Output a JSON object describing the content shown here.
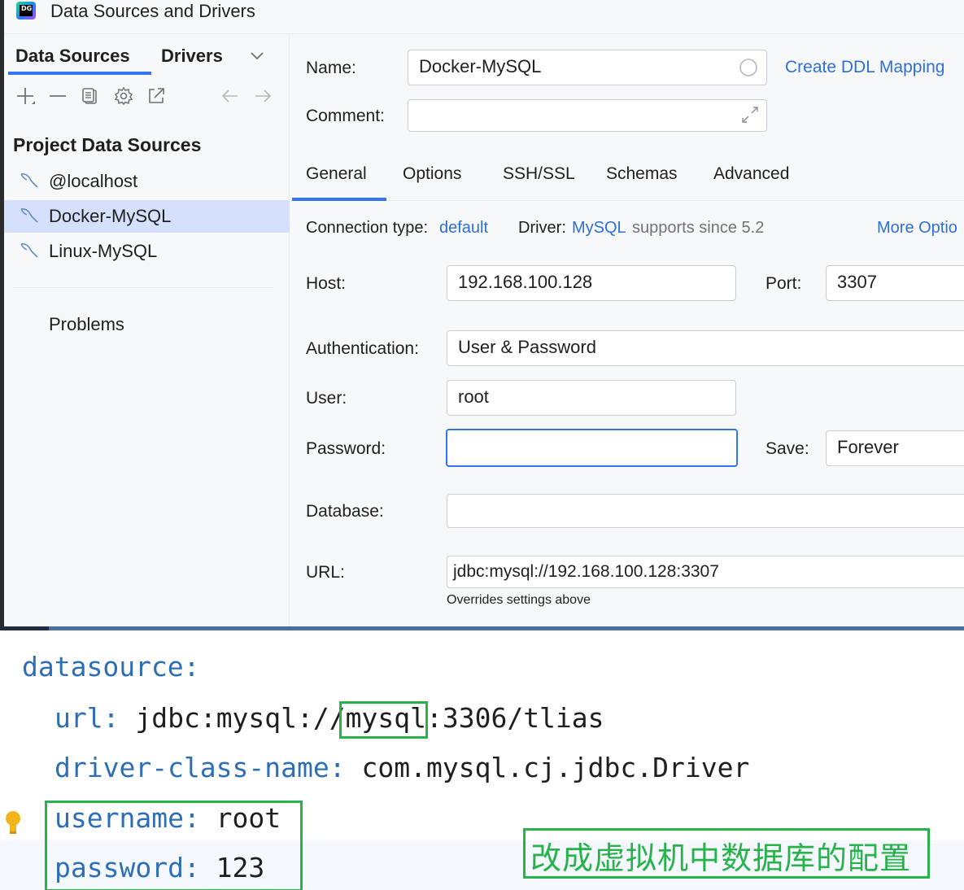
{
  "window": {
    "title": "Data Sources and Drivers",
    "logo_text": "DG"
  },
  "left_pane": {
    "tabs": [
      "Data Sources",
      "Drivers"
    ],
    "toolbar_icons": [
      "add-icon",
      "remove-icon",
      "duplicate-icon",
      "settings-icon",
      "open-external-icon",
      "back-arrow-icon",
      "forward-arrow-icon"
    ],
    "section_title": "Project Data Sources",
    "items": [
      {
        "label": "@localhost",
        "selected": false
      },
      {
        "label": "Docker-MySQL",
        "selected": true
      },
      {
        "label": "Linux-MySQL",
        "selected": false
      }
    ],
    "problems_label": "Problems"
  },
  "right_pane": {
    "name_label": "Name:",
    "name_value": "Docker-MySQL",
    "create_ddl_link": "Create DDL Mapping",
    "comment_label": "Comment:",
    "comment_value": "",
    "tabs": [
      "General",
      "Options",
      "SSH/SSL",
      "Schemas",
      "Advanced"
    ],
    "active_tab": "General",
    "connection_type_label": "Connection type:",
    "connection_type_value": "default",
    "driver_label": "Driver:",
    "driver_value": "MySQL",
    "driver_note": "supports since 5.2",
    "more_options_link": "More Optio",
    "host_label": "Host:",
    "host_value": "192.168.100.128",
    "port_label": "Port:",
    "port_value": "3307",
    "auth_label": "Authentication:",
    "auth_value": "User & Password",
    "user_label": "User:",
    "user_value": "root",
    "password_label": "Password:",
    "password_value": "",
    "save_label": "Save:",
    "save_value": "Forever",
    "database_label": "Database:",
    "database_value": "",
    "url_label": "URL:",
    "url_value": "jdbc:mysql://192.168.100.128:3307",
    "url_note": "Overrides settings above"
  },
  "code": {
    "line1_key": "datasource:",
    "line2_key": "url:",
    "line2_prefix": " jdbc:mysql://",
    "line2_highlight": "mysql",
    "line2_suffix": ":3306/tlias",
    "line3_key": "driver-class-name:",
    "line3_value": " com.mysql.cj.jdbc.Driver",
    "line4_key": "username:",
    "line4_value": " root",
    "line5_key": "password:",
    "line5_value": " 123"
  },
  "annotation": {
    "note": "改成虚拟机中数据库的配置",
    "color": "#27b24a"
  },
  "colors": {
    "accent": "#3574f0",
    "selection": "#d5e1fc",
    "link": "#2f6fd6",
    "yaml_key": "#2d6fb7"
  }
}
